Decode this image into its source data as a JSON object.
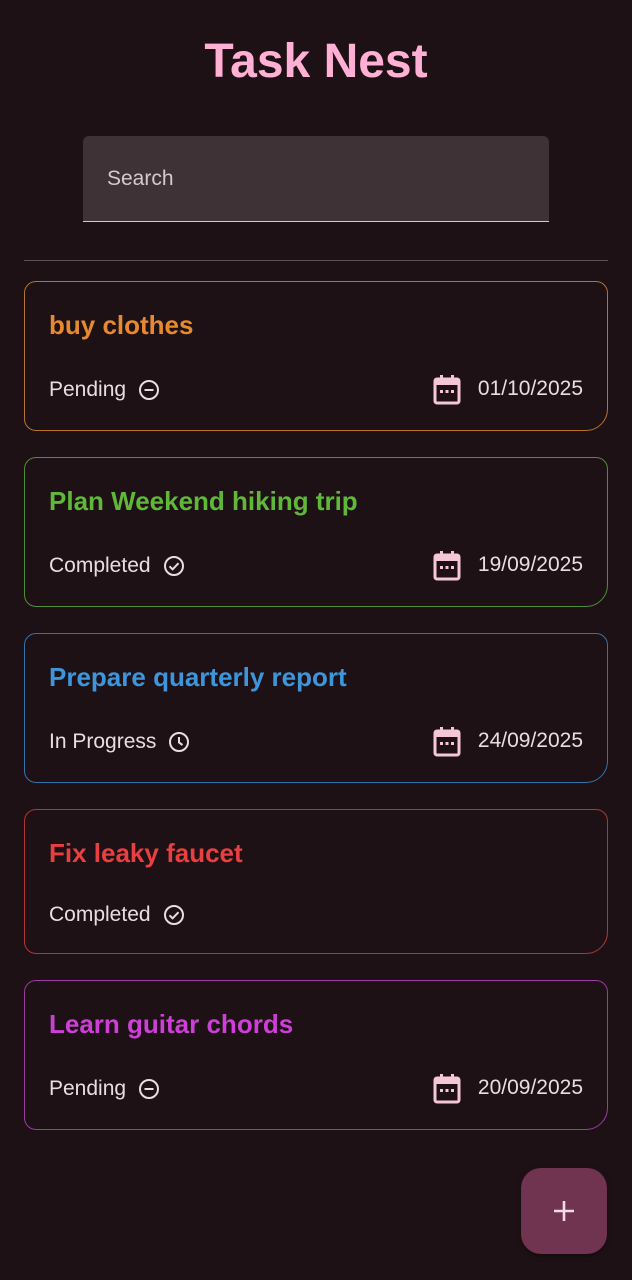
{
  "app": {
    "title": "Task Nest"
  },
  "search": {
    "placeholder": "Search",
    "value": ""
  },
  "tasks": [
    {
      "title": "buy clothes",
      "status": "Pending",
      "status_icon": "minus-circle-icon",
      "date": "01/10/2025",
      "color": "#e68a2e"
    },
    {
      "title": "Plan Weekend hiking trip",
      "status": "Completed",
      "status_icon": "check-circle-icon",
      "date": "19/09/2025",
      "color": "#5fb838"
    },
    {
      "title": "Prepare quarterly report",
      "status": "In Progress",
      "status_icon": "clock-icon",
      "date": "24/09/2025",
      "color": "#3d96db"
    },
    {
      "title": "Fix leaky faucet",
      "status": "Completed",
      "status_icon": "check-circle-icon",
      "date": "",
      "color": "#e83f40"
    },
    {
      "title": "Learn guitar chords",
      "status": "Pending",
      "status_icon": "minus-circle-icon",
      "date": "20/09/2025",
      "color": "#cd3fd6"
    }
  ],
  "fab": {
    "icon": "plus-icon"
  },
  "colors": {
    "background": "#1e1116",
    "title": "#ffb0d4",
    "text": "#eadde2",
    "calendar_icon": "#f5c6d6",
    "fab": "#703350"
  }
}
